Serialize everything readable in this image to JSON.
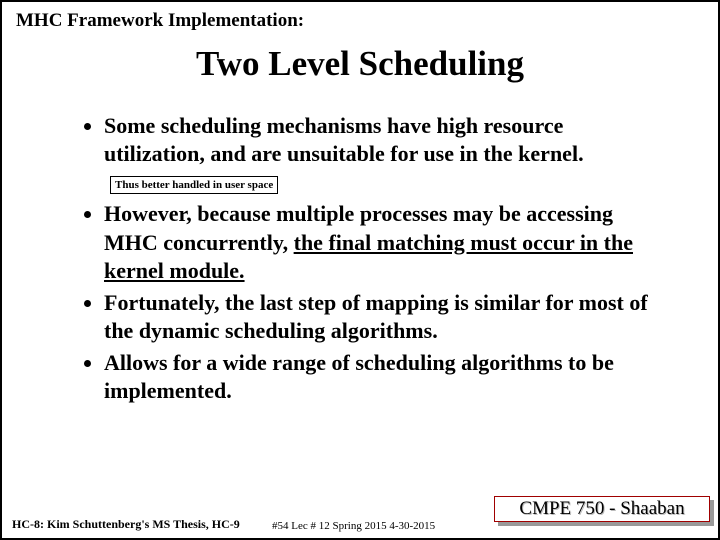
{
  "section_label": "MHC Framework Implementation:",
  "title": "Two Level Scheduling",
  "bullets": {
    "b1_part1": "Some scheduling mechanisms have high resource utilization, and are unsuitable for use in the kernel.",
    "b1_annotation": "Thus better handled in user space",
    "b2_part1": "However, because multiple processes may be accessing MHC concurrently, ",
    "b2_underlined": "the final matching must occur in the kernel module.",
    "b3": "Fortunately, the last step of mapping is similar for most of the dynamic scheduling algorithms.",
    "b4": "Allows for a wide range of scheduling algorithms to be implemented."
  },
  "footer_left": "HC-8: Kim Schuttenberg's MS Thesis, HC-9",
  "footer_center": "#54  Lec # 12  Spring 2015 4-30-2015",
  "course_box": "CMPE 750 - Shaaban"
}
